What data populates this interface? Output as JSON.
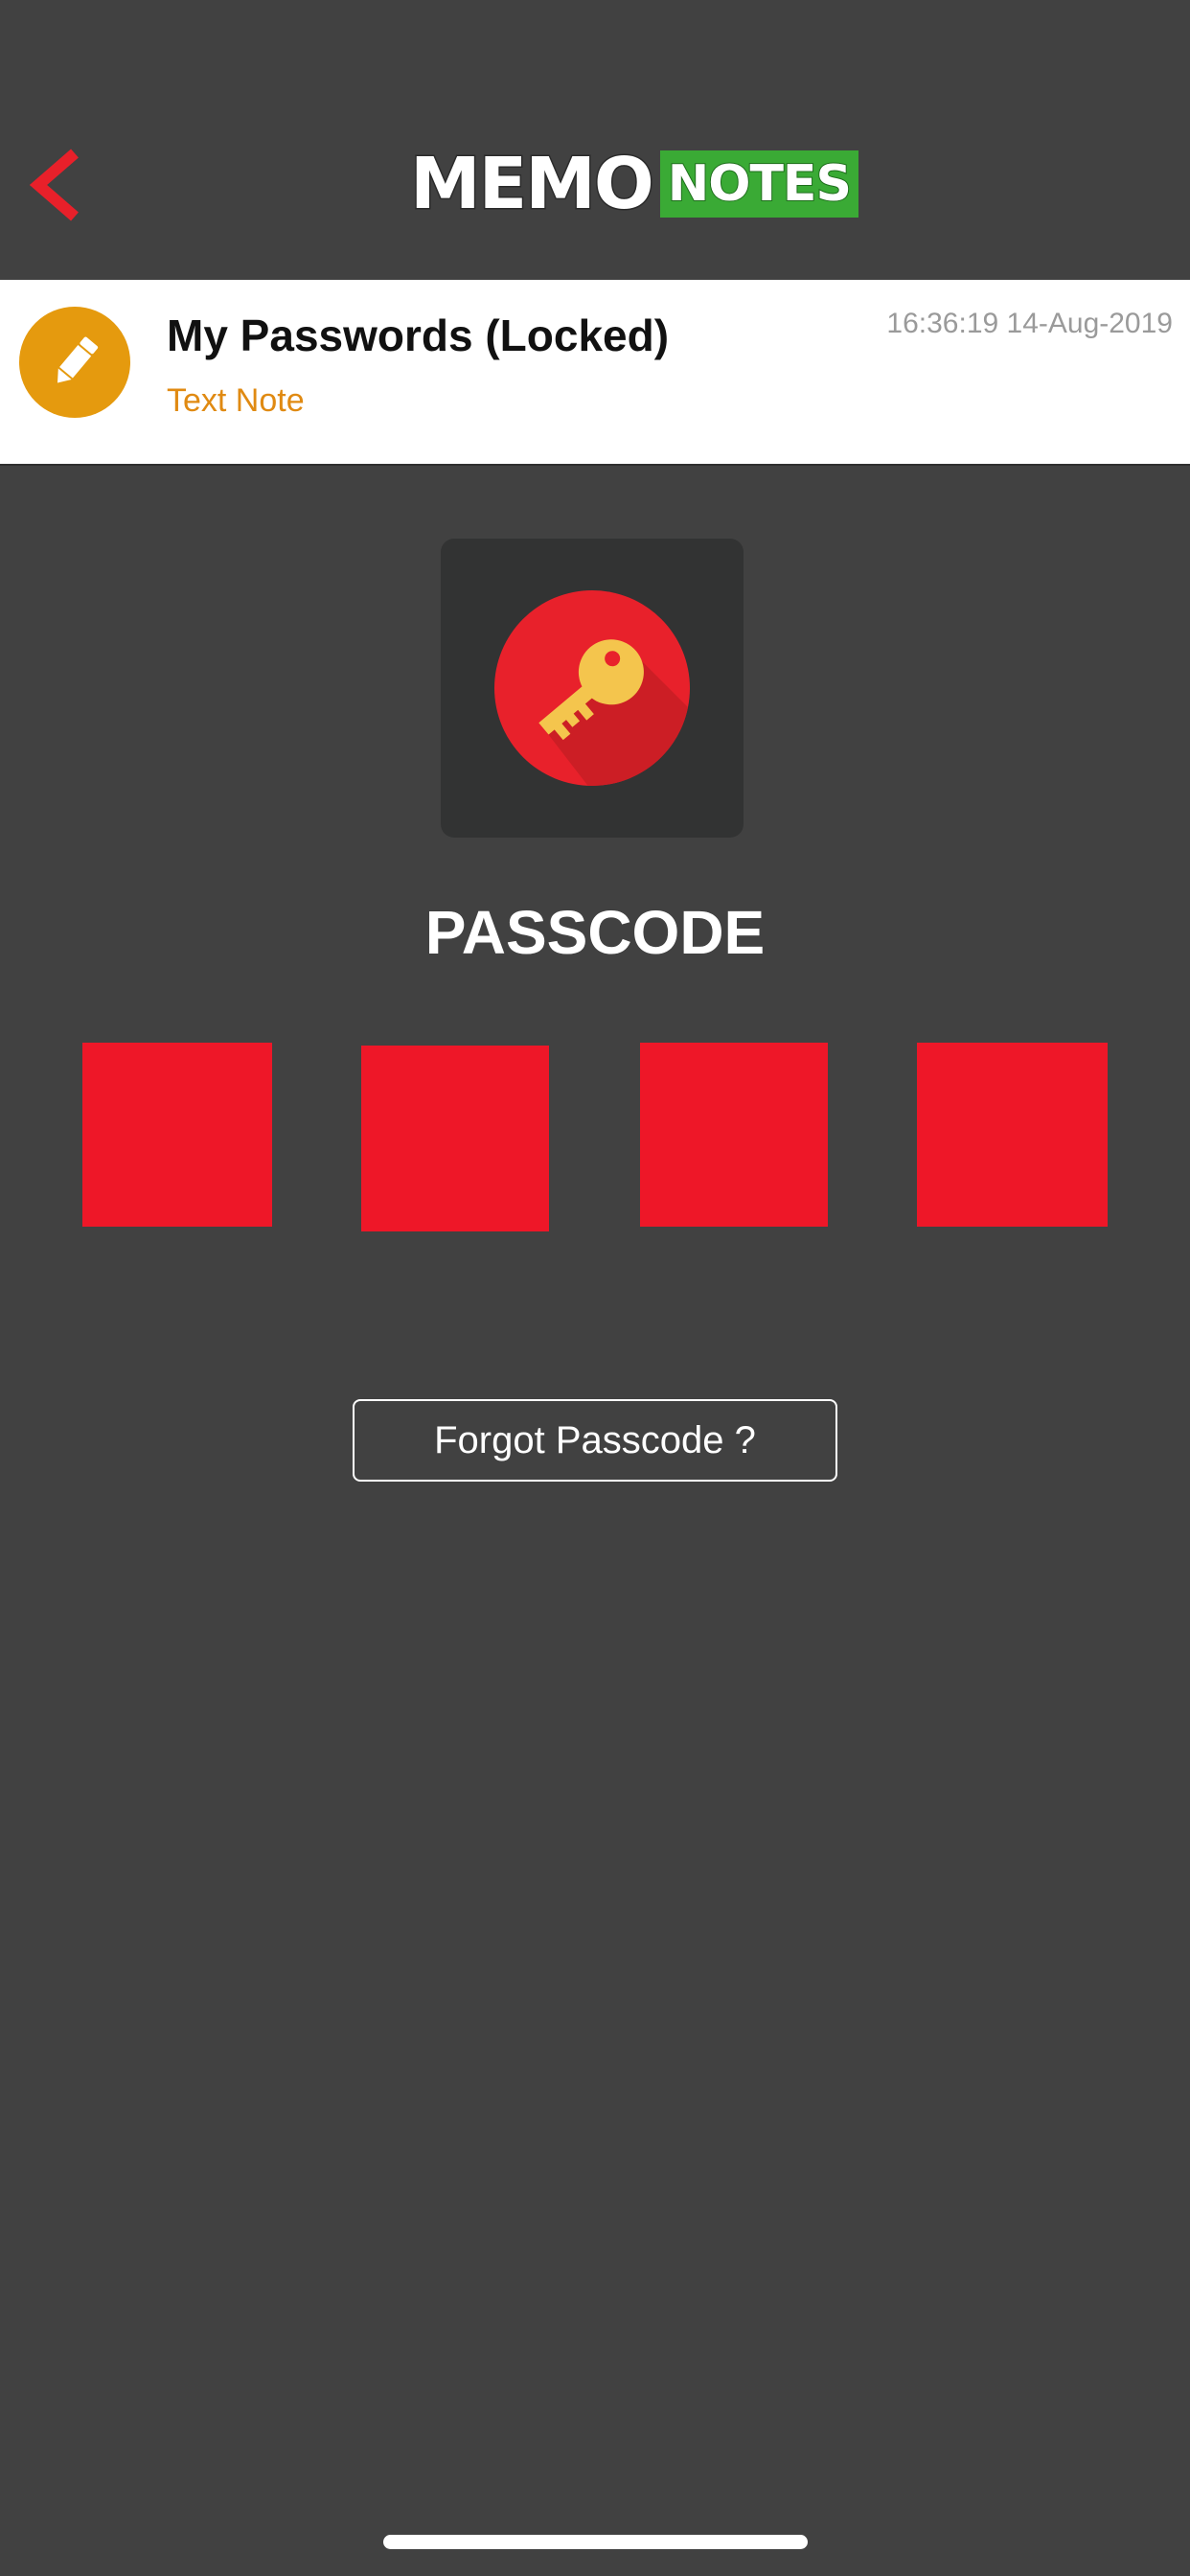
{
  "header": {
    "back_icon": "chevron-left-icon",
    "logo": {
      "memo": "MEMO",
      "notes": "NOTES"
    }
  },
  "note": {
    "title": "My Passwords (Locked)",
    "type": "Text Note",
    "timestamp": "16:36:19 14-Aug-2019",
    "icon": "pencil-icon"
  },
  "lock": {
    "icon": "key-icon",
    "label": "PASSCODE",
    "digits_count": 4
  },
  "actions": {
    "forgot_label": "Forgot Passcode ?"
  },
  "colors": {
    "background": "#414141",
    "accent_red": "#ee1728",
    "note_orange": "#e59a0e",
    "logo_green": "#3aaa35"
  }
}
